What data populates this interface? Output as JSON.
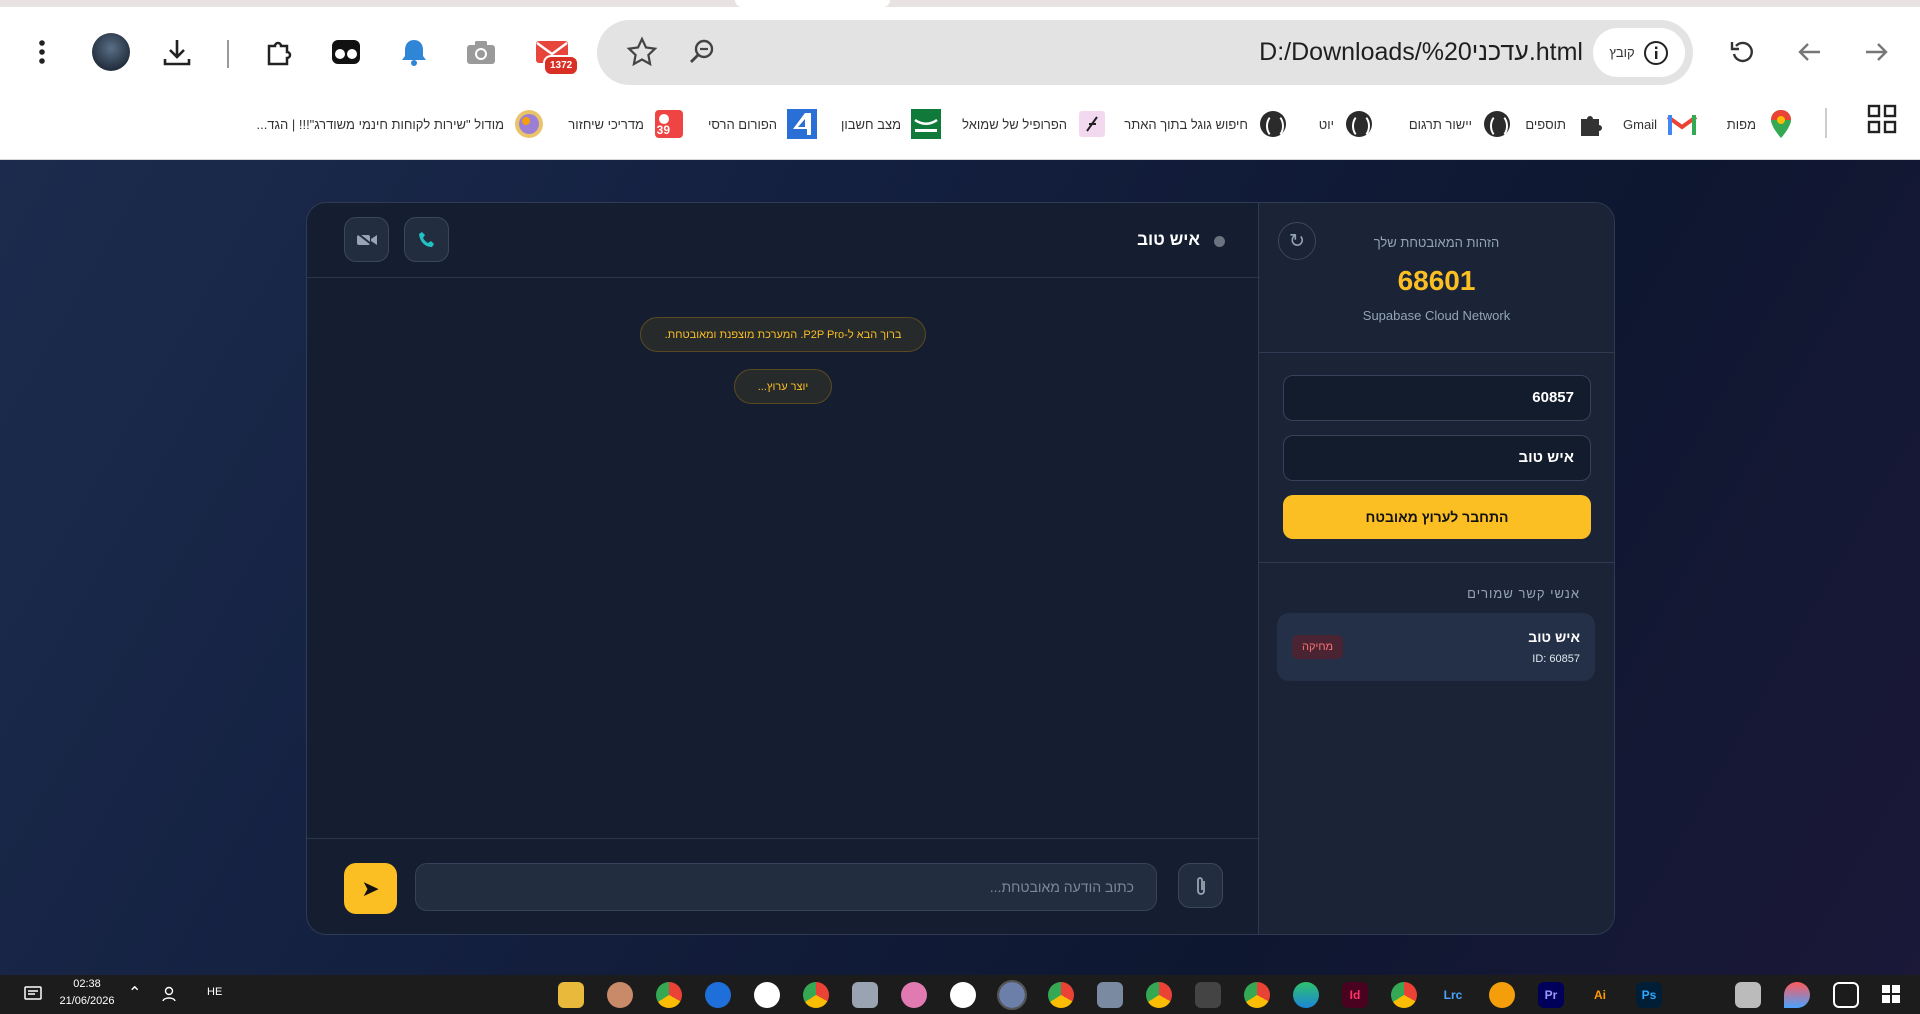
{
  "browser": {
    "url": "D:/Downloads/עדכני%20.html",
    "site_chip": "קובץ",
    "mail_count": "1372",
    "bookmarks": [
      {
        "label": "מפות",
        "icon": "maps-pin-icon"
      },
      {
        "label": "Gmail",
        "icon": "gmail-icon"
      },
      {
        "label": "תוספים",
        "icon": "puzzle-icon"
      },
      {
        "label": "יישור תרגום",
        "icon": "globe-icon"
      },
      {
        "label": "יוט",
        "icon": "globe-icon"
      },
      {
        "label": "חיפוש גוגל בתוך האתר",
        "icon": "globe-icon"
      },
      {
        "label": "הפרופיל של שמואל",
        "icon": "profile-icon"
      },
      {
        "label": "מצב חשבון",
        "icon": "bank-icon"
      },
      {
        "label": "הפורום הרסי",
        "icon": "forum-icon"
      },
      {
        "label": "מדריכי שיחזור",
        "icon": "restore-icon"
      },
      {
        "label": "מודול \"שירות לקוחות חינמי משודרג\"!!! | הגד...",
        "icon": "module-icon"
      }
    ]
  },
  "app": {
    "identity_label": "הזהות המאובטחת שלך",
    "my_id": "68601",
    "network_name": "Supabase Cloud Network",
    "peer_id_value": "60857",
    "peer_name_value": "איש טוב",
    "connect_label": "התחבר לערוץ מאובטח",
    "contacts_title": "אנשי קשר שמורים",
    "contacts": [
      {
        "name": "איש טוב",
        "id_text": "ID: 60857",
        "delete_label": "מחיקה"
      }
    ],
    "chat_peer_name": "איש טוב",
    "messages": [
      "ברוך הבא ל-P2P Pro. המערכת מוצפנת ומאובטחת.",
      "יוצר ערוץ..."
    ],
    "input_placeholder": "כתוב הודעה מאובטחת...",
    "send_glyph": "➤"
  },
  "taskbar": {
    "time": "02:38",
    "date": "21/06/2026",
    "lang": "HE",
    "apps": [
      "Id",
      "Lrc",
      "Pr",
      "Ai",
      "Ps"
    ]
  },
  "colors": {
    "accent": "#fbbf24",
    "background": "#0f172a",
    "danger": "#f87171"
  }
}
